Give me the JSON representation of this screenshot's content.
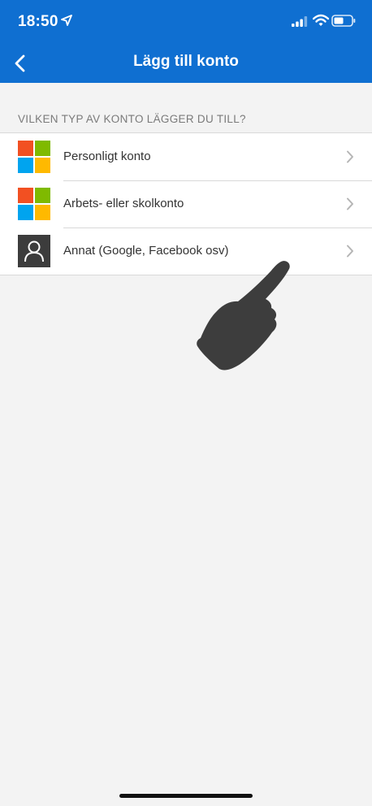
{
  "status_bar": {
    "time": "18:50",
    "icons": [
      "location-arrow-icon",
      "signal-icon",
      "wifi-icon",
      "battery-icon"
    ]
  },
  "nav": {
    "title": "Lägg till konto",
    "back_icon": "chevron-left-icon"
  },
  "section_header": "VILKEN TYP AV KONTO LÄGGER DU TILL?",
  "accounts": [
    {
      "label": "Personligt konto",
      "icon": "microsoft-logo-icon"
    },
    {
      "label": "Arbets- eller skolkonto",
      "icon": "microsoft-logo-icon"
    },
    {
      "label": "Annat (Google, Facebook osv)",
      "icon": "person-icon"
    }
  ],
  "colors": {
    "header_blue": "#0f6fd1",
    "ms_red": "#f25022",
    "ms_green": "#7fba00",
    "ms_blue": "#00a4ef",
    "ms_yellow": "#ffb900",
    "background": "#f3f3f3"
  },
  "overlay": {
    "icon": "pointing-hand-icon"
  }
}
